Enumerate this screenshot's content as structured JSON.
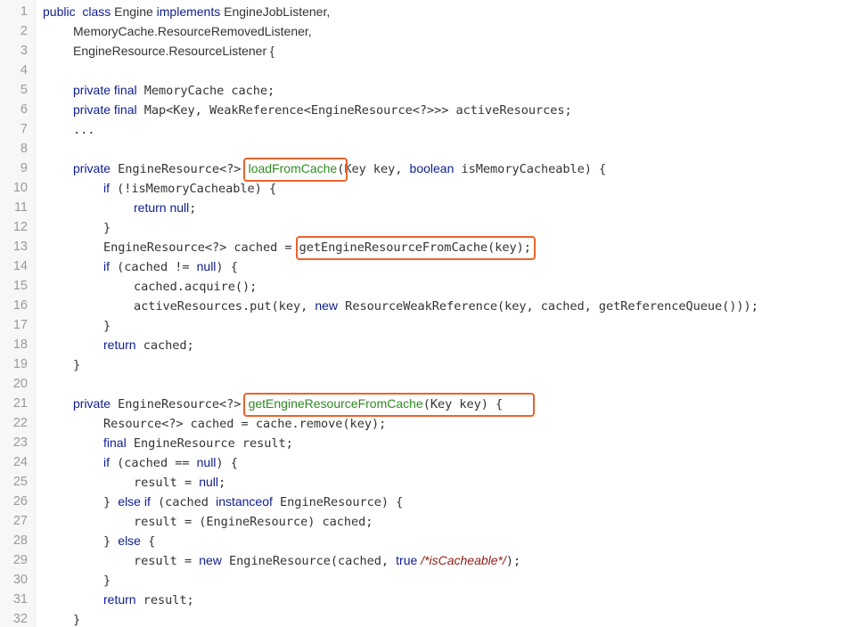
{
  "lines": [
    {
      "n": "1",
      "indent": 0,
      "segs": [
        {
          "t": "public",
          "c": "kw"
        },
        {
          "t": "  ",
          "c": "prop"
        },
        {
          "t": "class",
          "c": "kw"
        },
        {
          "t": " Engine ",
          "c": "prop"
        },
        {
          "t": "implements",
          "c": "kw"
        },
        {
          "t": " EngineJobListener,",
          "c": "prop"
        }
      ]
    },
    {
      "n": "2",
      "indent": 1,
      "segs": [
        {
          "t": "MemoryCache.ResourceRemovedListener,",
          "c": "prop"
        }
      ]
    },
    {
      "n": "3",
      "indent": 1,
      "segs": [
        {
          "t": "EngineResource.ResourceListener {",
          "c": "prop"
        }
      ]
    },
    {
      "n": "4",
      "indent": 0,
      "segs": []
    },
    {
      "n": "5",
      "indent": 1,
      "segs": [
        {
          "t": "private",
          "c": "kw"
        },
        {
          "t": " ",
          "c": "prop"
        },
        {
          "t": "final",
          "c": "kw"
        },
        {
          "t": " MemoryCache cache;",
          "c": "mono"
        }
      ]
    },
    {
      "n": "6",
      "indent": 1,
      "segs": [
        {
          "t": "private",
          "c": "kw"
        },
        {
          "t": " ",
          "c": "prop"
        },
        {
          "t": "final",
          "c": "kw"
        },
        {
          "t": " Map<Key, WeakReference<EngineResource<?>>> activeResources;",
          "c": "mono"
        }
      ]
    },
    {
      "n": "7",
      "indent": 1,
      "segs": [
        {
          "t": "...",
          "c": "mono"
        }
      ]
    },
    {
      "n": "8",
      "indent": 0,
      "segs": []
    },
    {
      "n": "9",
      "indent": 1,
      "segs": [
        {
          "t": "private",
          "c": "kw"
        },
        {
          "t": " EngineResource<?> ",
          "c": "mono"
        },
        {
          "t": "loadFromCache",
          "c": "fn"
        },
        {
          "t": "(Key key, ",
          "c": "mono"
        },
        {
          "t": "boolean",
          "c": "kw"
        },
        {
          "t": " isMemoryCacheable) {",
          "c": "mono"
        }
      ]
    },
    {
      "n": "10",
      "indent": 2,
      "segs": [
        {
          "t": "if",
          "c": "kw"
        },
        {
          "t": " (!isMemoryCacheable) {",
          "c": "mono"
        }
      ]
    },
    {
      "n": "11",
      "indent": 3,
      "segs": [
        {
          "t": "return",
          "c": "kw"
        },
        {
          "t": " ",
          "c": "prop"
        },
        {
          "t": "null",
          "c": "kw"
        },
        {
          "t": ";",
          "c": "mono"
        }
      ]
    },
    {
      "n": "12",
      "indent": 2,
      "segs": [
        {
          "t": "}",
          "c": "mono"
        }
      ]
    },
    {
      "n": "13",
      "indent": 2,
      "segs": [
        {
          "t": "EngineResource<?> cached = getEngineResourceFromCache(key);",
          "c": "mono"
        }
      ]
    },
    {
      "n": "14",
      "indent": 2,
      "segs": [
        {
          "t": "if",
          "c": "kw"
        },
        {
          "t": " (cached != ",
          "c": "mono"
        },
        {
          "t": "null",
          "c": "kw"
        },
        {
          "t": ") {",
          "c": "mono"
        }
      ]
    },
    {
      "n": "15",
      "indent": 3,
      "segs": [
        {
          "t": "cached.acquire();",
          "c": "mono"
        }
      ]
    },
    {
      "n": "16",
      "indent": 3,
      "segs": [
        {
          "t": "activeResources.put(key, ",
          "c": "mono"
        },
        {
          "t": "new",
          "c": "kw"
        },
        {
          "t": " ResourceWeakReference(key, cached, getReferenceQueue()));",
          "c": "mono"
        }
      ]
    },
    {
      "n": "17",
      "indent": 2,
      "segs": [
        {
          "t": "}",
          "c": "mono"
        }
      ]
    },
    {
      "n": "18",
      "indent": 2,
      "segs": [
        {
          "t": "return",
          "c": "kw"
        },
        {
          "t": " cached;",
          "c": "mono"
        }
      ]
    },
    {
      "n": "19",
      "indent": 1,
      "segs": [
        {
          "t": "}",
          "c": "mono"
        }
      ]
    },
    {
      "n": "20",
      "indent": 0,
      "segs": []
    },
    {
      "n": "21",
      "indent": 1,
      "segs": [
        {
          "t": "private",
          "c": "kw"
        },
        {
          "t": " EngineResource<?> ",
          "c": "mono"
        },
        {
          "t": "getEngineResourceFromCache",
          "c": "fn"
        },
        {
          "t": "(Key key) {",
          "c": "mono"
        }
      ]
    },
    {
      "n": "22",
      "indent": 2,
      "segs": [
        {
          "t": "Resource<?> cached = cache.remove(key);",
          "c": "mono"
        }
      ]
    },
    {
      "n": "23",
      "indent": 2,
      "segs": [
        {
          "t": "final",
          "c": "kw"
        },
        {
          "t": " EngineResource result;",
          "c": "mono"
        }
      ]
    },
    {
      "n": "24",
      "indent": 2,
      "segs": [
        {
          "t": "if",
          "c": "kw"
        },
        {
          "t": " (cached == ",
          "c": "mono"
        },
        {
          "t": "null",
          "c": "kw"
        },
        {
          "t": ") {",
          "c": "mono"
        }
      ]
    },
    {
      "n": "25",
      "indent": 3,
      "segs": [
        {
          "t": "result = ",
          "c": "mono"
        },
        {
          "t": "null",
          "c": "kw"
        },
        {
          "t": ";",
          "c": "mono"
        }
      ]
    },
    {
      "n": "26",
      "indent": 2,
      "segs": [
        {
          "t": "} ",
          "c": "mono"
        },
        {
          "t": "else",
          "c": "kw"
        },
        {
          "t": " ",
          "c": "prop"
        },
        {
          "t": "if",
          "c": "kw"
        },
        {
          "t": " (cached ",
          "c": "mono"
        },
        {
          "t": "instanceof",
          "c": "kw"
        },
        {
          "t": " EngineResource) {",
          "c": "mono"
        }
      ]
    },
    {
      "n": "27",
      "indent": 3,
      "segs": [
        {
          "t": "result = (EngineResource) cached;",
          "c": "mono"
        }
      ]
    },
    {
      "n": "28",
      "indent": 2,
      "segs": [
        {
          "t": "} ",
          "c": "mono"
        },
        {
          "t": "else",
          "c": "kw"
        },
        {
          "t": " {",
          "c": "mono"
        }
      ]
    },
    {
      "n": "29",
      "indent": 3,
      "segs": [
        {
          "t": "result = ",
          "c": "mono"
        },
        {
          "t": "new",
          "c": "kw"
        },
        {
          "t": " EngineResource(cached, ",
          "c": "mono"
        },
        {
          "t": "true",
          "c": "kw"
        },
        {
          "t": " ",
          "c": "prop"
        },
        {
          "t": "/*isCacheable*/",
          "c": "com"
        },
        {
          "t": ");",
          "c": "mono"
        }
      ]
    },
    {
      "n": "30",
      "indent": 2,
      "segs": [
        {
          "t": "}",
          "c": "mono"
        }
      ]
    },
    {
      "n": "31",
      "indent": 2,
      "segs": [
        {
          "t": "return",
          "c": "kw"
        },
        {
          "t": " result;",
          "c": "mono"
        }
      ]
    },
    {
      "n": "32",
      "indent": 1,
      "segs": [
        {
          "t": "}",
          "c": "mono"
        }
      ]
    }
  ],
  "highlights": [
    {
      "line": "9",
      "text": "loadFromCache("
    },
    {
      "line": "13",
      "text": "getEngineResourceFromCache(key);"
    },
    {
      "line": "21",
      "text": "getEngineResourceFromCache(Key key) {"
    }
  ],
  "colors": {
    "highlight": "#e8642c",
    "keyword": "#0d1d8f",
    "function": "#2f8a22",
    "comment": "#8c1c13",
    "gutter": "#f7f7f7",
    "line_number": "#9a9a9a"
  }
}
